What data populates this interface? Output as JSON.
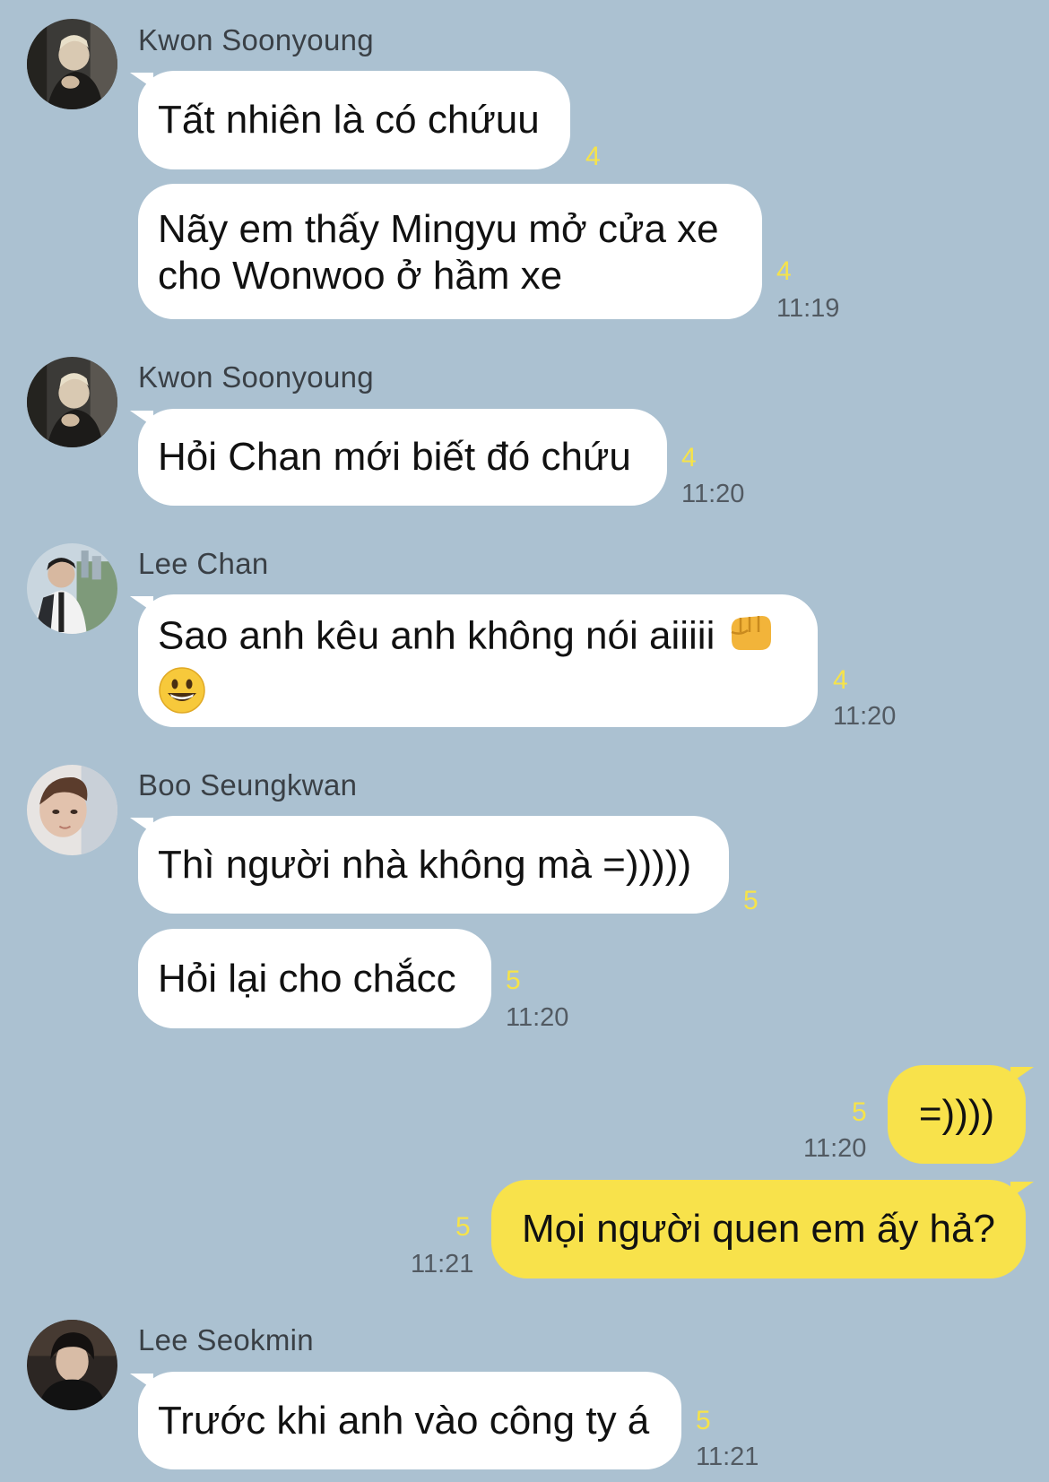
{
  "colors": {
    "background": "#abc1d1",
    "incoming_bubble": "#ffffff",
    "outgoing_bubble": "#f8e24b",
    "unread_count": "#f6e34a",
    "timestamp": "#525a62"
  },
  "groups": [
    {
      "sender": "Kwon Soonyoung",
      "avatar_icon": "profile-photo-kwon-soonyoung",
      "messages": [
        {
          "text": "Tất nhiên là có chứuu",
          "unread": "4",
          "time": ""
        },
        {
          "line1": "Nãy em thấy Mingyu mở cửa xe",
          "line2": "cho Wonwoo ở hầm xe",
          "unread": "4",
          "time": "11:19"
        }
      ]
    },
    {
      "sender": "Kwon Soonyoung",
      "avatar_icon": "profile-photo-kwon-soonyoung",
      "messages": [
        {
          "text": "Hỏi Chan mới biết đó chứu",
          "unread": "4",
          "time": "11:20"
        }
      ]
    },
    {
      "sender": "Lee Chan",
      "avatar_icon": "profile-photo-lee-chan",
      "messages": [
        {
          "line1": "Sao anh kêu anh không nói aiiiii",
          "emoji1": "oncoming-fist-emoji",
          "emoji2": "grinning-face-emoji",
          "unread": "4",
          "time": "11:20"
        }
      ]
    },
    {
      "sender": "Boo Seungkwan",
      "avatar_icon": "profile-photo-boo-seungkwan",
      "messages": [
        {
          "text": "Thì người nhà không mà =)))))",
          "unread": "5",
          "time": ""
        },
        {
          "text": "Hỏi lại cho chắcc",
          "unread": "5",
          "time": "11:20"
        }
      ]
    },
    {
      "sender": "",
      "outgoing": true,
      "messages": [
        {
          "text": "=))))",
          "unread": "5",
          "time": "11:20"
        },
        {
          "text": "Mọi người quen em ấy hả?",
          "unread": "5",
          "time": "11:21"
        }
      ]
    },
    {
      "sender": "Lee Seokmin",
      "avatar_icon": "profile-photo-lee-seokmin",
      "messages": [
        {
          "text": "Trước khi anh vào công ty á",
          "unread": "5",
          "time": "11:21"
        }
      ]
    }
  ]
}
